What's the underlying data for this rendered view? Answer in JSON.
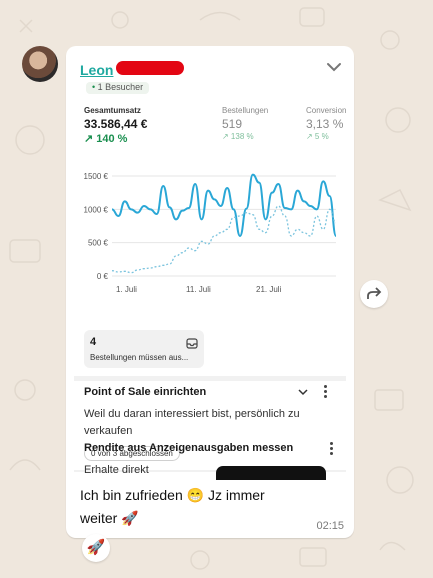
{
  "message": {
    "sender": "Leon",
    "time": "02:15",
    "caption_line1": "Ich bin zufrieden 😁 Jz immer",
    "caption_line2": "weiter 🚀",
    "reaction": "🚀"
  },
  "dashboard": {
    "visitors_label": "1 Besucher",
    "metrics": [
      {
        "label": "Gesamtumsatz",
        "value": "33.586,44 €",
        "change": "↗ 140 %"
      },
      {
        "label": "Bestellungen",
        "value": "519",
        "change": "↗ 138 %"
      },
      {
        "label": "Conversion",
        "value": "3,13 %",
        "change": "↗ 5 %"
      }
    ],
    "chart_data": {
      "type": "line",
      "y_ticks": [
        "1500 €",
        "1000 €",
        "500 €",
        "0 €"
      ],
      "x_ticks": [
        "1. Juli",
        "11. Juli",
        "21. Juli"
      ],
      "ylim": [
        0,
        1500
      ],
      "series": [
        {
          "style": "solid",
          "color": "#2aa7d6",
          "values": [
            1000,
            900,
            1120,
            1000,
            950,
            1050,
            1000,
            930,
            1350,
            1030,
            850,
            980,
            1020,
            1380,
            850,
            1280,
            1150,
            1050,
            1320,
            1000,
            600,
            1010,
            1520,
            1400,
            850,
            1250,
            1380,
            1020,
            1000,
            1280,
            1120,
            1050,
            1000,
            1420,
            1200,
            600
          ]
        },
        {
          "style": "dotted",
          "color": "#7cc4de",
          "values": [
            80,
            60,
            70,
            50,
            90,
            110,
            120,
            140,
            160,
            180,
            300,
            350,
            420,
            380,
            520,
            480,
            600,
            650,
            700,
            880,
            900,
            950,
            920,
            700,
            650,
            900,
            1050,
            900,
            600,
            700,
            650,
            600,
            900,
            700,
            1000,
            800
          ]
        }
      ]
    },
    "orders_card": {
      "count": "4",
      "text": "Bestellungen müssen aus..."
    },
    "task1": {
      "title": "Point of Sale einrichten",
      "desc": "Weil du daran interessiert bist, persönlich zu verkaufen",
      "progress": "0 von 3 abgeschlossen"
    },
    "task2": {
      "title": "Rendite aus Anzeigenausgaben messen",
      "desc": "Erhalte direkt"
    }
  },
  "colors": {
    "brand": "#1fa9a0",
    "positive": "#1a8f4f",
    "chat_bg": "#efe7dd"
  }
}
